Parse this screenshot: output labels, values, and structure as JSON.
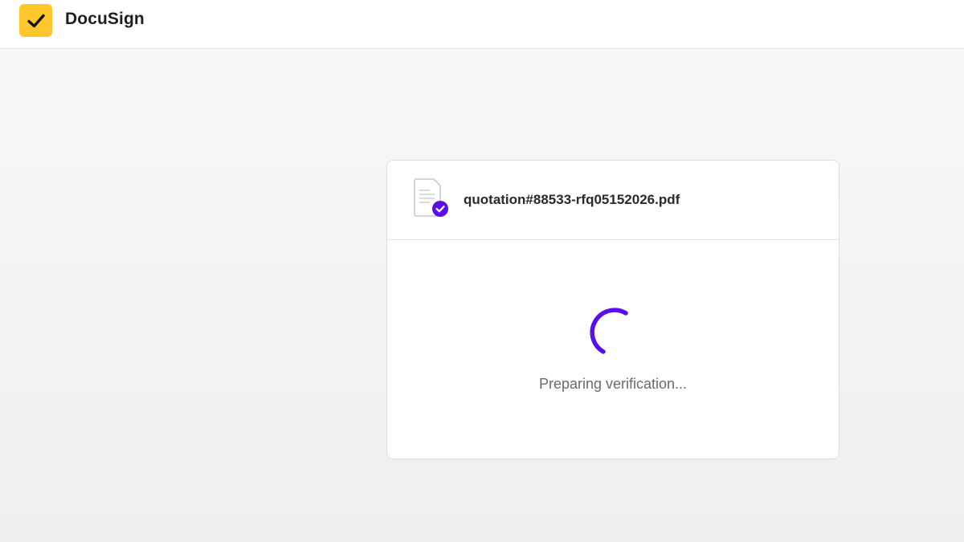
{
  "header": {
    "brand_name": "DocuSign",
    "logo_icon": "checkmark-icon",
    "logo_color": "#ffc72c"
  },
  "card": {
    "document": {
      "icon": "document-verified-icon",
      "filename": "quotation#88533-rfq05152026.pdf"
    },
    "loading": {
      "spinner_icon": "loading-spinner-icon",
      "accent_color": "#5a0fe8",
      "status_text": "Preparing verification..."
    }
  }
}
